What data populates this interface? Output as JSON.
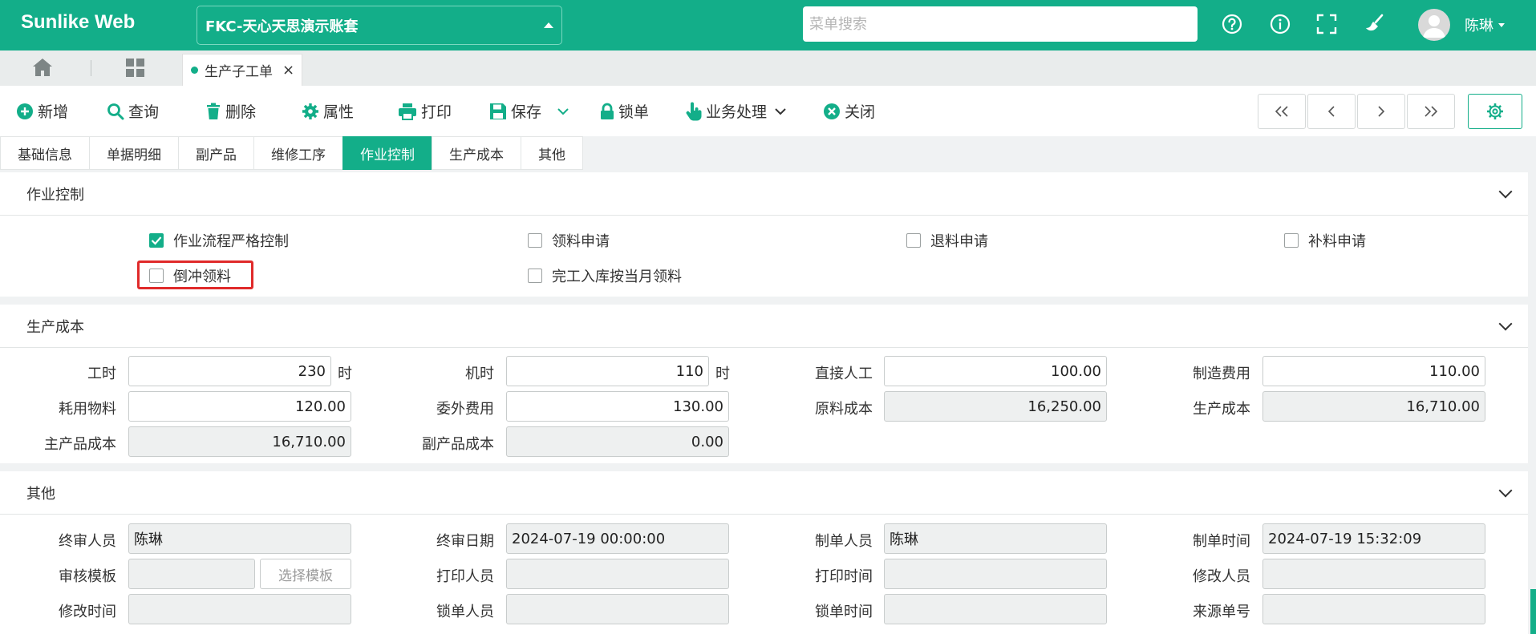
{
  "app": {
    "brand": "Sunlike Web",
    "account": "FKC-天心天思演示账套",
    "search_placeholder": "菜单搜索",
    "user": "陈琳"
  },
  "page_tab": {
    "label": "生产子工单"
  },
  "toolbar": {
    "add": "新增",
    "query": "查询",
    "delete": "删除",
    "props": "属性",
    "print": "打印",
    "save": "保存",
    "lock": "锁单",
    "business": "业务处理",
    "close": "关闭"
  },
  "form_tabs": [
    "基础信息",
    "单据明细",
    "副产品",
    "维修工序",
    "作业控制",
    "生产成本",
    "其他"
  ],
  "ops": {
    "title": "作业控制",
    "strict": "作业流程严格控制",
    "pick_req": "领料申请",
    "return_req": "退料申请",
    "supp_req": "补料申请",
    "backflush": "倒冲领料",
    "month_pick": "完工入库按当月领料"
  },
  "cost": {
    "title": "生产成本",
    "labor_hours_label": "工时",
    "labor_hours": "230",
    "hours_unit": "时",
    "machine_hours_label": "机时",
    "machine_hours": "110",
    "direct_labor_label": "直接人工",
    "direct_labor": "100.00",
    "mfg_expense_label": "制造费用",
    "mfg_expense": "110.00",
    "consumables_label": "耗用物料",
    "consumables": "120.00",
    "outsource_label": "委外费用",
    "outsource": "130.00",
    "material_cost_label": "原料成本",
    "material_cost": "16,250.00",
    "production_cost_label": "生产成本",
    "production_cost": "16,710.00",
    "main_cost_label": "主产品成本",
    "main_cost": "16,710.00",
    "by_cost_label": "副产品成本",
    "by_cost": "0.00"
  },
  "other": {
    "title": "其他",
    "final_reviewer_label": "终审人员",
    "final_reviewer": "陈琳",
    "final_date_label": "终审日期",
    "final_date": "2024-07-19 00:00:00",
    "creator_label": "制单人员",
    "creator": "陈琳",
    "created_label": "制单时间",
    "created": "2024-07-19 15:32:09",
    "template_label": "审核模板",
    "template_btn": "选择模板",
    "printer_label": "打印人员",
    "print_time_label": "打印时间",
    "modifier_label": "修改人员",
    "modify_time_label": "修改时间",
    "locker_label": "锁单人员",
    "lock_time_label": "锁单时间",
    "source_label": "来源单号"
  }
}
